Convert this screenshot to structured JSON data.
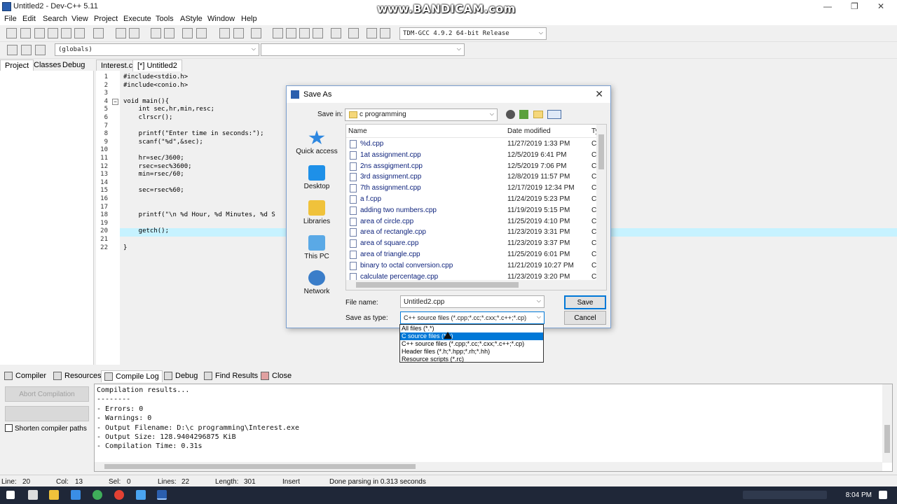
{
  "window": {
    "title": "Untitled2 - Dev-C++ 5.11",
    "controls": [
      "—",
      "❐",
      "✕"
    ]
  },
  "watermark": "www.BANDICAM.com",
  "menu": [
    "File",
    "Edit",
    "Search",
    "View",
    "Project",
    "Execute",
    "Tools",
    "AStyle",
    "Window",
    "Help"
  ],
  "toolbar": {
    "compiler": "TDM-GCC 4.9.2 64-bit Release",
    "scope": "(globals)",
    "symbol": ""
  },
  "left_tabs": [
    "Project",
    "Classes",
    "Debug"
  ],
  "editor_tabs": [
    {
      "label": "Interest.c",
      "active": false
    },
    {
      "label": "[*] Untitled2",
      "active": true
    }
  ],
  "code": [
    {
      "n": "1",
      "fold": "",
      "text": "#include<stdio.h>"
    },
    {
      "n": "2",
      "fold": "",
      "text": "#include<conio.h>"
    },
    {
      "n": "3",
      "fold": "",
      "text": ""
    },
    {
      "n": "4",
      "fold": "−",
      "text": "void main(){"
    },
    {
      "n": "5",
      "fold": "",
      "text": "    int sec,hr,min,resc;"
    },
    {
      "n": "6",
      "fold": "",
      "text": "    clrscr();"
    },
    {
      "n": "7",
      "fold": "",
      "text": ""
    },
    {
      "n": "8",
      "fold": "",
      "text": "    printf(\"Enter time in seconds:\");"
    },
    {
      "n": "9",
      "fold": "",
      "text": "    scanf(\"%d\",&sec);"
    },
    {
      "n": "10",
      "fold": "",
      "text": ""
    },
    {
      "n": "11",
      "fold": "",
      "text": "    hr=sec/3600;"
    },
    {
      "n": "12",
      "fold": "",
      "text": "    rsec=sec%3600;"
    },
    {
      "n": "13",
      "fold": "",
      "text": "    min=rsec/60;"
    },
    {
      "n": "14",
      "fold": "",
      "text": ""
    },
    {
      "n": "15",
      "fold": "",
      "text": "    sec=rsec%60;"
    },
    {
      "n": "16",
      "fold": "",
      "text": ""
    },
    {
      "n": "17",
      "fold": "",
      "text": ""
    },
    {
      "n": "18",
      "fold": "",
      "text": "    printf(\"\\n %d Hour, %d Minutes, %d S"
    },
    {
      "n": "19",
      "fold": "",
      "text": ""
    },
    {
      "n": "20",
      "fold": "",
      "text": "    getch();"
    },
    {
      "n": "21",
      "fold": "",
      "text": ""
    },
    {
      "n": "22",
      "fold": "",
      "text": "}"
    }
  ],
  "dialog": {
    "title": "Save As",
    "save_in_label": "Save in:",
    "save_in_value": "c programming",
    "places": [
      "Quick access",
      "Desktop",
      "Libraries",
      "This PC",
      "Network"
    ],
    "headers": {
      "name": "Name",
      "date": "Date modified",
      "type": "Ty"
    },
    "files": [
      {
        "name": "%d.cpp",
        "date": "11/27/2019 1:33 PM",
        "type": "C-"
      },
      {
        "name": "1at assignment.cpp",
        "date": "12/5/2019 6:41 PM",
        "type": "C-"
      },
      {
        "name": "2ns assgigment.cpp",
        "date": "12/5/2019 7:06 PM",
        "type": "C-"
      },
      {
        "name": "3rd assignment.cpp",
        "date": "12/8/2019 11:57 PM",
        "type": "C-"
      },
      {
        "name": "7th assignment.cpp",
        "date": "12/17/2019 12:34 PM",
        "type": "C-"
      },
      {
        "name": "a f.cpp",
        "date": "11/24/2019 5:23 PM",
        "type": "C-"
      },
      {
        "name": "adding two numbers.cpp",
        "date": "11/19/2019 5:15 PM",
        "type": "C-"
      },
      {
        "name": "area of circle.cpp",
        "date": "11/25/2019 4:10 PM",
        "type": "C-"
      },
      {
        "name": "area of rectangle.cpp",
        "date": "11/23/2019 3:31 PM",
        "type": "C-"
      },
      {
        "name": "area of square.cpp",
        "date": "11/23/2019 3:37 PM",
        "type": "C-"
      },
      {
        "name": "area of triangle.cpp",
        "date": "11/25/2019 6:01 PM",
        "type": "C-"
      },
      {
        "name": "binary to octal conversion.cpp",
        "date": "11/21/2019 10:27 PM",
        "type": "C-"
      },
      {
        "name": "calculate percentage.cpp",
        "date": "11/23/2019 3:20 PM",
        "type": "C-"
      }
    ],
    "filename_label": "File name:",
    "filename_value": "Untitled2.cpp",
    "type_label": "Save as type:",
    "type_value": "C++ source files (*.cpp;*.cc;*.cxx;*.c++;*.cp)",
    "save_button": "Save",
    "cancel_button": "Cancel",
    "type_options": [
      {
        "label": "All files (*.*)",
        "selected": false
      },
      {
        "label": "C source files (*.c)",
        "selected": true
      },
      {
        "label": "C++ source files (*.cpp;*.cc;*.cxx;*.c++;*.cp)",
        "selected": false
      },
      {
        "label": "Header files (*.h;*.hpp;*.rh;*.hh)",
        "selected": false
      },
      {
        "label": "Resource scripts (*.rc)",
        "selected": false
      }
    ]
  },
  "bottom_tabs": [
    {
      "label": "Compiler",
      "active": false
    },
    {
      "label": "Resources",
      "active": false
    },
    {
      "label": "Compile Log",
      "active": true
    },
    {
      "label": "Debug",
      "active": false
    },
    {
      "label": "Find Results",
      "active": false
    },
    {
      "label": "Close",
      "active": false
    }
  ],
  "abort_button": "Abort Compilation",
  "shorten_label": "Shorten compiler paths",
  "log": [
    "Compilation results...",
    "--------",
    "- Errors: 0",
    "- Warnings: 0",
    "- Output Filename: D:\\c programming\\Interest.exe",
    "- Output Size: 128.9404296875 KiB",
    "- Compilation Time: 0.31s"
  ],
  "status": {
    "line_label": "Line:",
    "line": "20",
    "col_label": "Col:",
    "col": "13",
    "sel_label": "Sel:",
    "sel": "0",
    "lines_label": "Lines:",
    "lines": "22",
    "length_label": "Length:",
    "length": "301",
    "mode": "Insert",
    "message": "Done parsing in 0.313 seconds"
  },
  "taskbar": {
    "time": "8:04 PM"
  },
  "colors": {
    "accent": "#0078d7",
    "current_line": "#c6f2ff",
    "taskbar": "#1f2738"
  }
}
